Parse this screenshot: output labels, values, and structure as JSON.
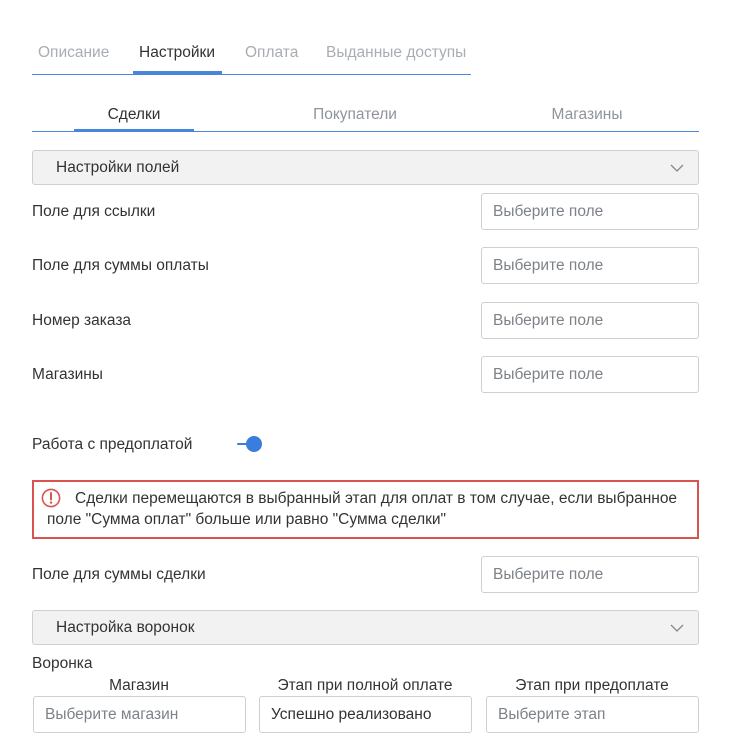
{
  "top_tabs": [
    {
      "label": "Описание",
      "active": false
    },
    {
      "label": "Настройки",
      "active": true
    },
    {
      "label": "Оплата",
      "active": false
    },
    {
      "label": "Выданные доступы",
      "active": false
    }
  ],
  "sub_tabs": [
    {
      "label": "Сделки",
      "active": true
    },
    {
      "label": "Покупатели",
      "active": false
    },
    {
      "label": "Магазины",
      "active": false
    }
  ],
  "fields_section": {
    "title": "Настройки полей",
    "fields": [
      {
        "label": "Поле для ссылки",
        "value": "",
        "placeholder": "Выберите поле"
      },
      {
        "label": "Поле для суммы оплаты",
        "value": "",
        "placeholder": "Выберите поле"
      },
      {
        "label": "Номер заказа",
        "value": "",
        "placeholder": "Выберите поле"
      },
      {
        "label": "Магазины",
        "value": "",
        "placeholder": "Выберите поле"
      }
    ]
  },
  "prepayment": {
    "label": "Работа с предоплатой",
    "enabled": true
  },
  "alert": {
    "icon": "exclamation-circle-icon",
    "color": "#d9534f",
    "text": "Сделки перемещаются в выбранный этап для оплат в том случае, если выбранное поле \"Сумма оплат\" больше или равно \"Сумма сделки\""
  },
  "deal_sum_field": {
    "label": "Поле для суммы сделки",
    "placeholder": "Выберите поле"
  },
  "funnels_section": {
    "title": "Настройка воронок",
    "group_label": "Воронка",
    "columns": [
      {
        "label": "Магазин",
        "value": "Выберите магазин",
        "is_placeholder": true
      },
      {
        "label": "Этап при полной оплате",
        "value": "Успешно реализовано",
        "is_placeholder": false
      },
      {
        "label": "Этап при предоплате",
        "value": "Выберите этап",
        "is_placeholder": true
      }
    ]
  },
  "colors": {
    "accent": "#4a86d8",
    "toggle": "#3b7dde",
    "error": "#d9534f"
  }
}
